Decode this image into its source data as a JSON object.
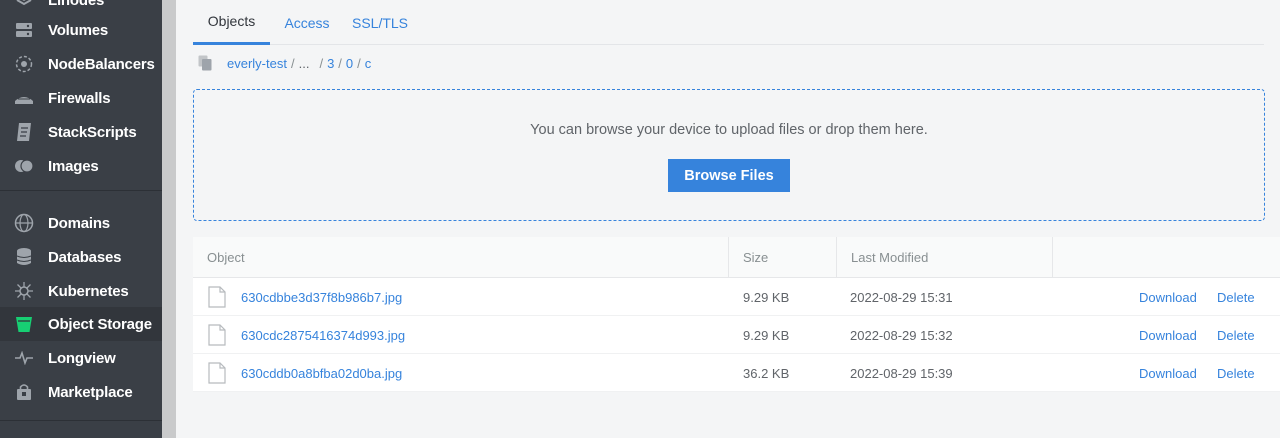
{
  "sidebar": {
    "items": [
      {
        "label": "Linodes",
        "icon": "linode-icon"
      },
      {
        "label": "Volumes",
        "icon": "volume-icon"
      },
      {
        "label": "NodeBalancers",
        "icon": "nodebalancer-icon"
      },
      {
        "label": "Firewalls",
        "icon": "firewall-icon"
      },
      {
        "label": "StackScripts",
        "icon": "stackscript-icon"
      },
      {
        "label": "Images",
        "icon": "images-icon"
      },
      {
        "label": "Domains",
        "icon": "globe-icon"
      },
      {
        "label": "Databases",
        "icon": "database-icon"
      },
      {
        "label": "Kubernetes",
        "icon": "kubernetes-icon"
      },
      {
        "label": "Object Storage",
        "icon": "bucket-icon"
      },
      {
        "label": "Longview",
        "icon": "pulse-icon"
      },
      {
        "label": "Marketplace",
        "icon": "marketplace-icon"
      }
    ],
    "active": "Object Storage",
    "active_color": "#17cf73"
  },
  "tabs": [
    {
      "label": "Objects"
    },
    {
      "label": "Access"
    },
    {
      "label": "SSL/TLS"
    }
  ],
  "breadcrumb": {
    "bucket": "everly-test",
    "ellipsis": "...",
    "parts": [
      "3",
      "0",
      "c"
    ],
    "separator": "/"
  },
  "dropzone": {
    "message": "You can browse your device to upload files or drop them here.",
    "button_label": "Browse Files"
  },
  "table": {
    "headers": {
      "object": "Object",
      "size": "Size",
      "modified": "Last Modified"
    },
    "rows": [
      {
        "name": "630cdbbe3d37f8b986b7.jpg",
        "size": "9.29 KB",
        "modified": "2022-08-29 15:31"
      },
      {
        "name": "630cdc2875416374d993.jpg",
        "size": "9.29 KB",
        "modified": "2022-08-29 15:32"
      },
      {
        "name": "630cddb0a8bfba02d0ba.jpg",
        "size": "36.2 KB",
        "modified": "2022-08-29 15:39"
      }
    ],
    "actions": {
      "download": "Download",
      "delete": "Delete"
    }
  },
  "colors": {
    "accent": "#3683dc",
    "sidebar_bg": "#3a3f46",
    "page_bg": "#f4f5f6"
  }
}
